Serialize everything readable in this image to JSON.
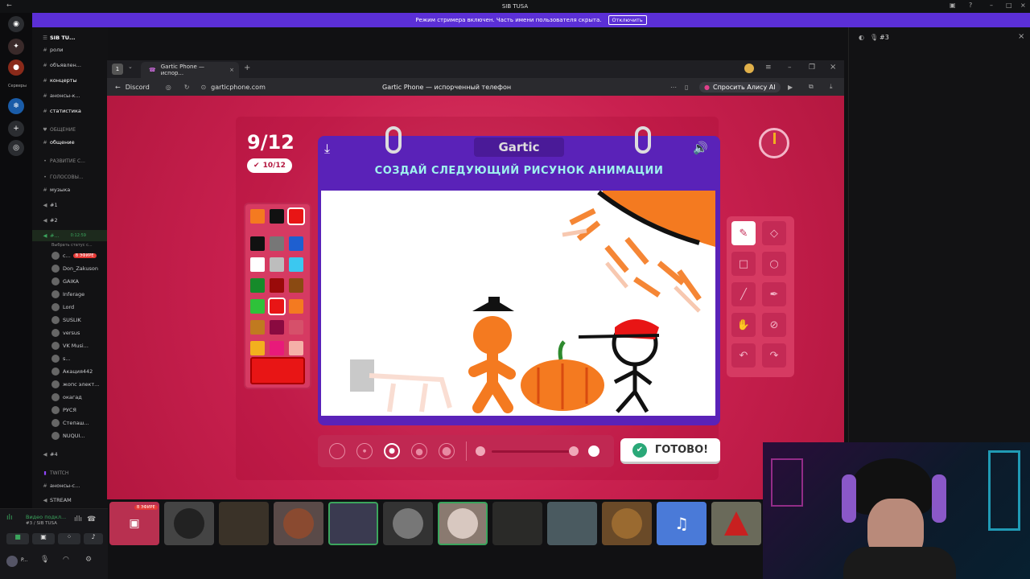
{
  "window": {
    "title": "SIB TUSA"
  },
  "streamer": {
    "message": "Режим стримера включен. Часть имени пользователя скрыта.",
    "button": "Отключить"
  },
  "rail": {
    "servers_label": "Серверы"
  },
  "sidebar": {
    "server_name": "SIB TU...",
    "channels": [
      {
        "icon": "#",
        "label": "роли"
      },
      {
        "icon": "#",
        "label": "объявлен..."
      },
      {
        "icon": "#",
        "label": "концерты"
      },
      {
        "icon": "#",
        "label": "анонсы-к..."
      },
      {
        "icon": "#",
        "label": "статистика"
      }
    ],
    "cat_general": "ОБЩЕНИЕ",
    "ch_general": "общение",
    "cat_dev": "РАЗВИТИЕ С...",
    "cat_voice": "ГОЛОСОВЫ...",
    "ch_music": "музыка",
    "voice1": "#1",
    "voice2": "#2",
    "active_voice": "#...",
    "active_time": "0:12:59",
    "active_status": "Выбрать статус с...",
    "users": [
      "c...",
      "Don_Zakuson",
      "GAIKA",
      "Inferage",
      "Lord",
      "SUSLIK",
      "versus",
      "VK Musi...",
      "s...",
      "Акация442",
      "жопс элект...",
      "окагад",
      "РУСЯ",
      "Степаш...",
      "NUQUI..."
    ],
    "live_badge": "В ЭФИРЕ",
    "voice4": "#4",
    "cat_twitch": "TWITCH",
    "ch_announce": "анонсы-с...",
    "ch_stream": "STREAM"
  },
  "voice_panel": {
    "title": "Видео подкл...",
    "sub": "#3 / SIB TUSA",
    "user": "P..."
  },
  "browser": {
    "tab_number": "1",
    "tab_title": "Gartic Phone — испор...",
    "back_label": "Discord",
    "url": "garticphone.com",
    "page_title": "Gartic Phone — испорченный телефон",
    "ask_ai": "Спросить Алису AI"
  },
  "game": {
    "counter": "9/12",
    "badge": "10/12",
    "logo": "Gartic",
    "heading": "СОЗДАЙ СЛЕДУЮЩИЙ РИСУНОК АНИМАЦИИ",
    "done_button": "ГОТОВО!",
    "palette": [
      "#f47a20",
      "#111111",
      "#e81515",
      "#111111",
      "#777777",
      "#1e5fd0",
      "#ffffff",
      "#bdbdbd",
      "#3bc8f0",
      "#168a2a",
      "#9a0a0a",
      "#8a4a12",
      "#2ec23a",
      "#e81515",
      "#f47a20",
      "#c07a20",
      "#8a0a40",
      "#d6506a",
      "#f2b01e",
      "#e81a7a",
      "#f5b0a8"
    ],
    "selected_color": "#e81515"
  },
  "right_panel": {
    "channel": "#3"
  },
  "strip": {
    "live_badge": "В ЭФИРЕ"
  }
}
